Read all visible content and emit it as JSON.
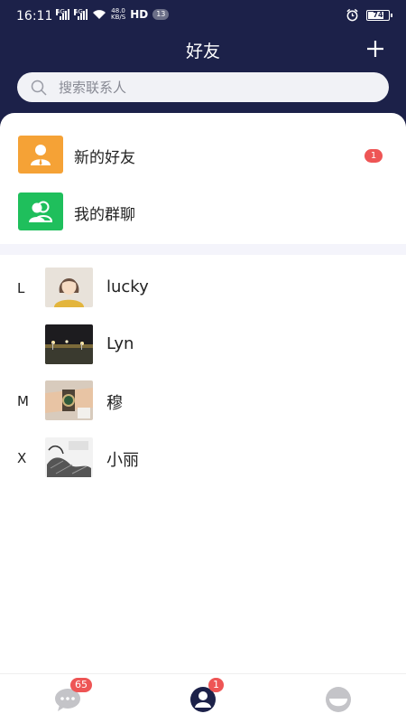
{
  "status_bar": {
    "time": "16:11",
    "sim1_label": "4G",
    "sim2_label": "4G",
    "net_speed_value": "48.0",
    "net_speed_unit": "KB/S",
    "hd_label": "HD",
    "notification_count": "13",
    "battery_level": "74"
  },
  "header": {
    "title": "好友",
    "add_icon": "plus-icon"
  },
  "search": {
    "placeholder": "搜索联系人",
    "icon": "search-icon"
  },
  "entries": [
    {
      "label": "新的好友",
      "icon": "new-friend-icon",
      "badge": "1",
      "color": "#f5a236"
    },
    {
      "label": "我的群聊",
      "icon": "group-chat-icon",
      "color": "#1fbf5c"
    }
  ],
  "contacts": [
    {
      "letter": "L",
      "name": "lucky",
      "avatar": "avatar-illustrated-woman"
    },
    {
      "letter": "",
      "name": "Lyn",
      "avatar": "avatar-night-city"
    },
    {
      "letter": "M",
      "name": "穆",
      "avatar": "avatar-wristwatch"
    },
    {
      "letter": "X",
      "name": "小丽",
      "avatar": "avatar-manga"
    }
  ],
  "tabbar": {
    "tabs": [
      {
        "name": "messages",
        "icon": "chat-bubble-icon",
        "badge": "65",
        "active": false
      },
      {
        "name": "contacts",
        "icon": "person-icon",
        "badge": "1",
        "active": true
      },
      {
        "name": "profile",
        "icon": "smile-face-icon",
        "active": false
      }
    ]
  },
  "colors": {
    "header_bg": "#1c2149",
    "badge_red": "#ee5555",
    "active_tab": "#1c2149",
    "inactive_tab": "#c4c4c8"
  }
}
